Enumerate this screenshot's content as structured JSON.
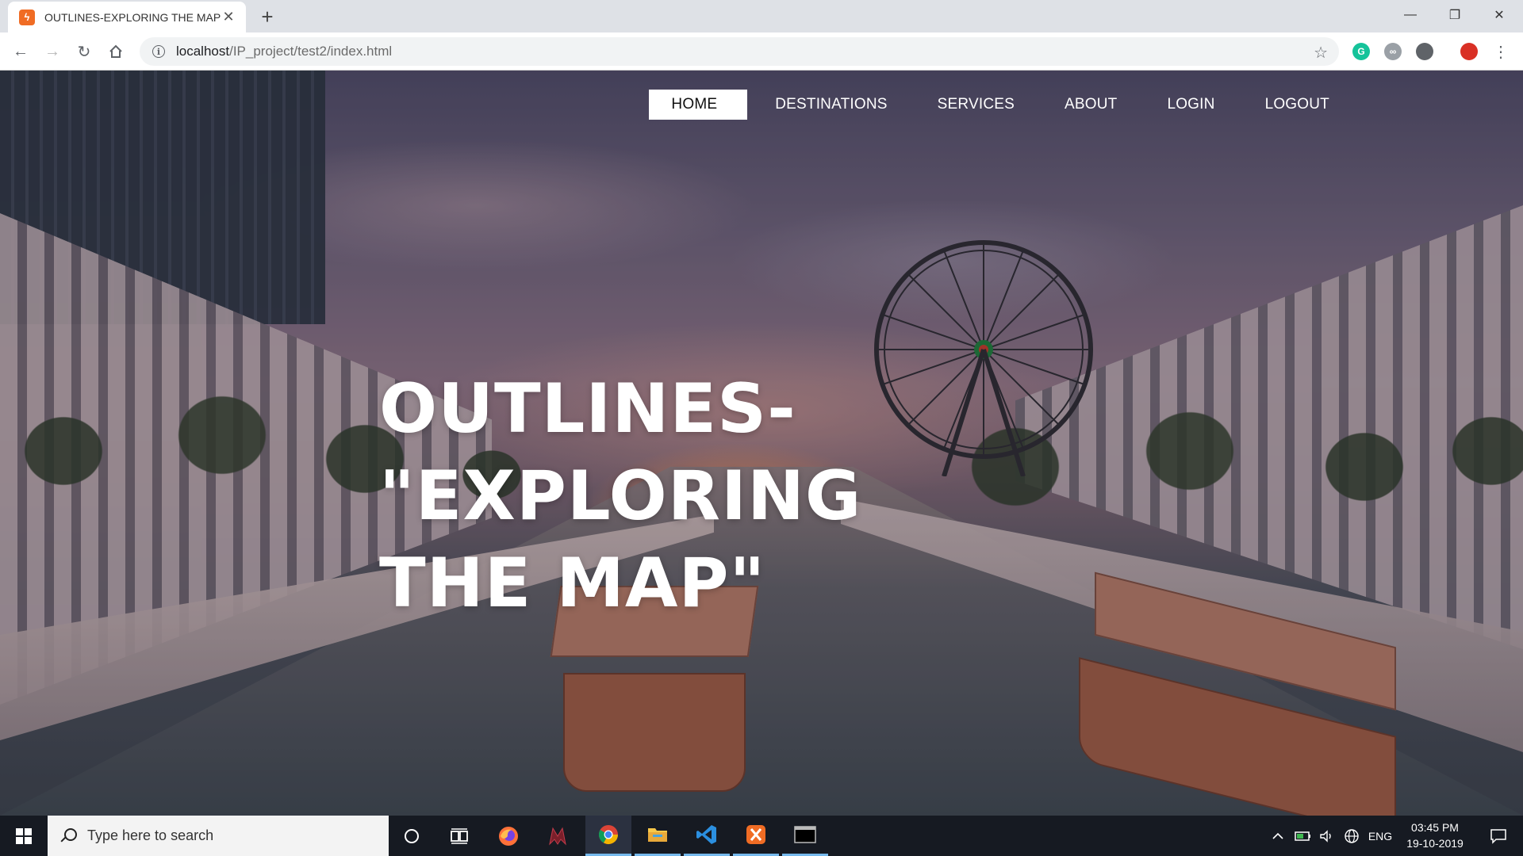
{
  "browser": {
    "tab_title": "OUTLINES-EXPLORING THE MAP",
    "tab_close": "✕",
    "new_tab": "+",
    "url_host": "localhost",
    "url_path": "/IP_project/test2/index.html"
  },
  "window_controls": {
    "minimize": "—",
    "restore": "❐",
    "close": "✕"
  },
  "site": {
    "nav": [
      {
        "label": "HOME",
        "active": true
      },
      {
        "label": "DESTINATIONS",
        "active": false
      },
      {
        "label": "SERVICES",
        "active": false
      },
      {
        "label": "ABOUT",
        "active": false
      },
      {
        "label": "LOGIN",
        "active": false
      },
      {
        "label": "LOGOUT",
        "active": false
      }
    ],
    "hero_line1": "OUTLINES-\"EXPLORING",
    "hero_line2": "THE MAP\""
  },
  "taskbar": {
    "search_placeholder": "Type here to search",
    "language": "ENG",
    "time": "03:45 PM",
    "date": "19-10-2019"
  },
  "colors": {
    "accent_active_nav": "#ffffff",
    "taskbar_bg": "#161a22",
    "favicon": "#f06c24"
  }
}
